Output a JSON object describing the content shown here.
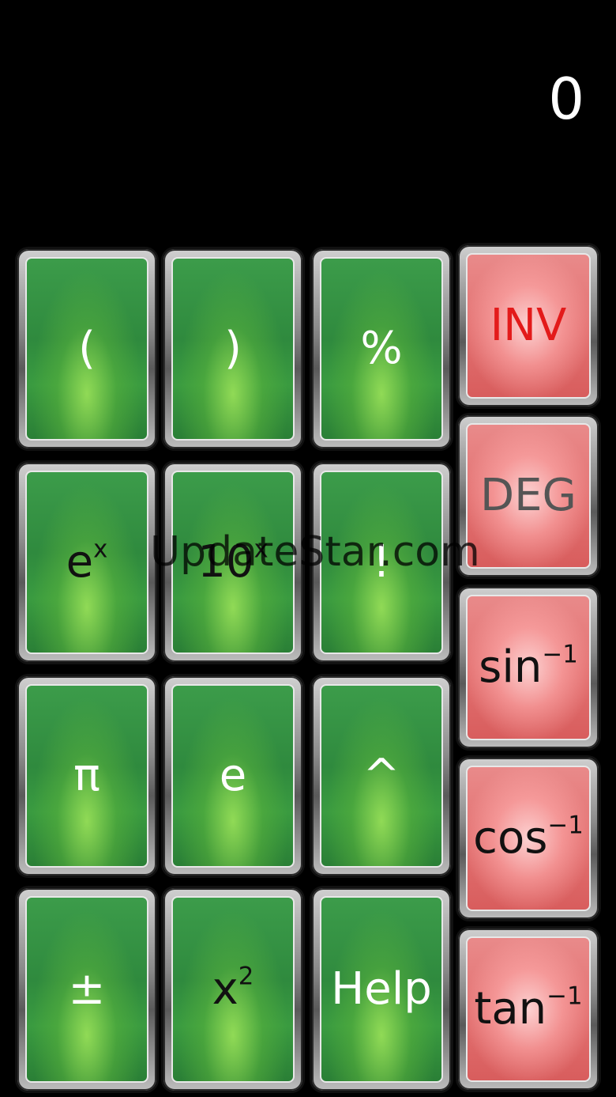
{
  "display": {
    "value": "0"
  },
  "watermark": "UpdateStar.com",
  "keys": {
    "open_paren": "(",
    "close_paren": ")",
    "percent": "%",
    "exp_base": "e",
    "exp_sup": "x",
    "ten_base": "10",
    "ten_sup": "x",
    "factorial": "!",
    "pi": "π",
    "e": "e",
    "power": "^",
    "plus_minus": "±",
    "square_base": "x",
    "square_sup": "2",
    "help": "Help",
    "inv": "INV",
    "deg": "DEG",
    "asin_base": "sin",
    "asin_sup": "−1",
    "acos_base": "cos",
    "acos_sup": "−1",
    "atan_base": "tan",
    "atan_sup": "−1"
  },
  "colors": {
    "green_key": "#2f8a3e",
    "red_key": "#e37272",
    "inv_text": "#e31a1a",
    "deg_text": "#555555"
  }
}
